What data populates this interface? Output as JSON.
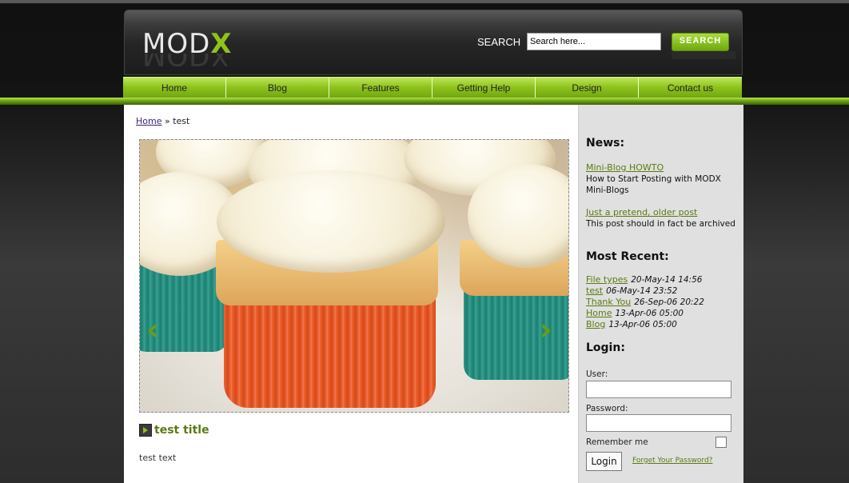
{
  "header": {
    "logo_main": "MOD",
    "logo_accent": "X",
    "search_label": "SEARCH",
    "search_placeholder": "Search here...",
    "search_button": "SEARCH"
  },
  "nav": [
    "Home",
    "Blog",
    "Features",
    "Getting Help",
    "Design",
    "Contact us"
  ],
  "breadcrumb": {
    "home": "Home",
    "separator": "»",
    "current": "test"
  },
  "post": {
    "title": "test title",
    "text": "test text"
  },
  "sidebar": {
    "news_heading": "News:",
    "news": [
      {
        "title": "Mini-Blog HOWTO",
        "desc": "How to Start Posting with MODX Mini-Blogs"
      },
      {
        "title": "Just a pretend, older post",
        "desc": "This post should in fact be archived"
      }
    ],
    "recent_heading": "Most Recent:",
    "recent": [
      {
        "title": "File types",
        "date": "20-May-14 14:56"
      },
      {
        "title": "test",
        "date": "06-May-14 23:52"
      },
      {
        "title": "Thank You",
        "date": "26-Sep-06 20:22"
      },
      {
        "title": "Home",
        "date": "13-Apr-06 05:00"
      },
      {
        "title": "Blog",
        "date": "13-Apr-06 05:00"
      }
    ],
    "login_heading": "Login:",
    "user_label": "User:",
    "password_label": "Password:",
    "remember_label": "Remember me",
    "login_button": "Login",
    "forgot_link": "Forget Your Password?"
  },
  "colors": {
    "accent": "#8fc21c",
    "link_green": "#5a7a12"
  },
  "slider": {
    "prev_icon": "chevron-left-icon",
    "next_icon": "chevron-right-icon"
  }
}
